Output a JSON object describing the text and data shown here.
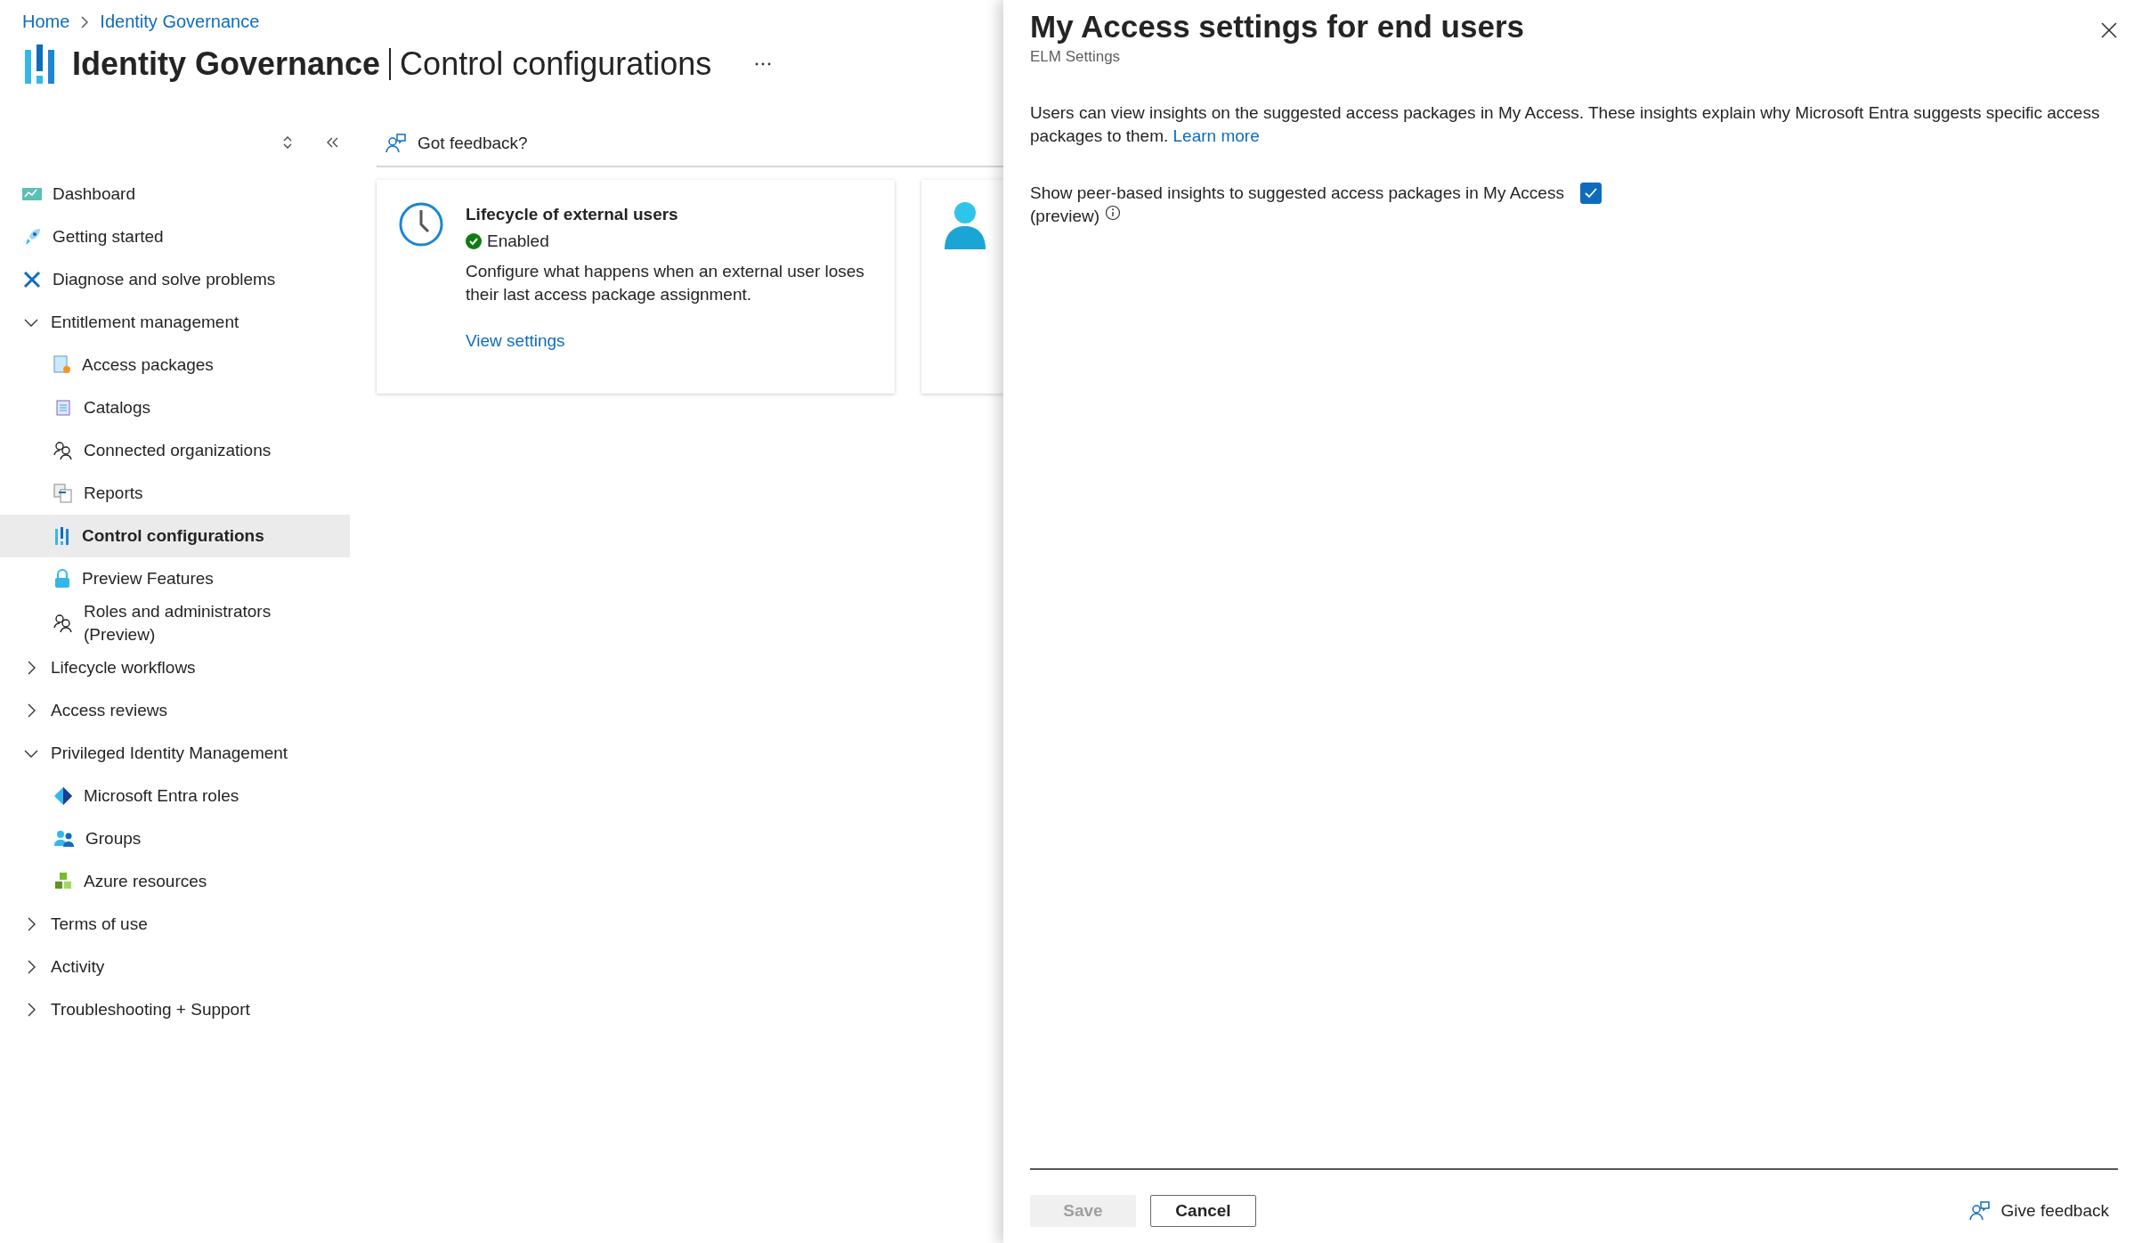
{
  "breadcrumb": [
    {
      "label": "Home"
    },
    {
      "label": "Identity Governance"
    }
  ],
  "page": {
    "title": "Identity Governance",
    "subtitle": "Control configurations"
  },
  "sidebar": {
    "items": [
      {
        "label": "Dashboard",
        "kind": "link",
        "selected": false
      },
      {
        "label": "Getting started",
        "kind": "link",
        "selected": false
      },
      {
        "label": "Diagnose and solve problems",
        "kind": "link",
        "selected": false
      },
      {
        "label": "Entitlement management",
        "kind": "group",
        "selected": false,
        "expanded": true,
        "children": [
          {
            "label": "Access packages",
            "selected": false
          },
          {
            "label": "Catalogs",
            "selected": false
          },
          {
            "label": "Connected organizations",
            "selected": false
          },
          {
            "label": "Reports",
            "selected": false
          },
          {
            "label": "Control configurations",
            "selected": true
          },
          {
            "label": "Preview Features",
            "selected": false
          },
          {
            "label": "Roles and administrators (Preview)",
            "selected": false
          }
        ]
      },
      {
        "label": "Lifecycle workflows",
        "kind": "group",
        "selected": false,
        "expanded": false
      },
      {
        "label": "Access reviews",
        "kind": "group",
        "selected": false,
        "expanded": false
      },
      {
        "label": "Privileged Identity Management",
        "kind": "group",
        "selected": false,
        "expanded": true,
        "children": [
          {
            "label": "Microsoft Entra roles",
            "selected": false
          },
          {
            "label": "Groups",
            "selected": false
          },
          {
            "label": "Azure resources",
            "selected": false
          }
        ]
      },
      {
        "label": "Terms of use",
        "kind": "group",
        "selected": false,
        "expanded": false
      },
      {
        "label": "Activity",
        "kind": "group",
        "selected": false,
        "expanded": false
      },
      {
        "label": "Troubleshooting + Support",
        "kind": "group",
        "selected": false,
        "expanded": false
      }
    ]
  },
  "feedback": {
    "label": "Got feedback?"
  },
  "cards": [
    {
      "kind": "full",
      "title": "Lifecycle of external users",
      "status": "Enabled",
      "enabled": true,
      "description": "Configure what happens when an external user loses their last access package assignment.",
      "link": "View settings"
    },
    {
      "kind": "cut"
    }
  ],
  "panel": {
    "title": "My Access settings for end users",
    "subtitle": "ELM Settings",
    "description": "Users can view insights on the suggested access packages in My Access. These insights explain why Microsoft Entra suggests specific access packages to them.",
    "link": "Learn more",
    "option": {
      "label": "Show peer-based insights to suggested access packages in My Access",
      "note": "(preview)",
      "checked": true
    },
    "buttons": [
      {
        "label": "Save",
        "disabled": true
      },
      {
        "label": "Cancel",
        "disabled": false
      }
    ],
    "feedback": "Give feedback"
  }
}
